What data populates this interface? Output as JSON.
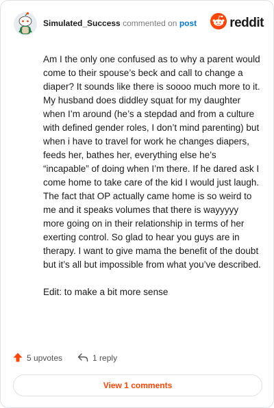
{
  "header": {
    "username": "Simulated_Success",
    "action": "commented on",
    "post_link": "post",
    "logo_text": "reddit"
  },
  "comment": {
    "paragraphs": [
      "Am I the only one confused as to why a parent would come to their spouse’s beck and call to change a diaper? It sounds like there is soooo much more to it. My husband does diddley squat for my daughter when I’m around (he’s a stepdad and from a culture with defined gender roles, I don’t mind parenting) but when i have to travel for work he changes diapers, feeds her, bathes her, everything else he’s “incapable” of doing when I’m there. If he dared ask I come home to take care of the kid I would just laugh. The fact that OP actually came home is so weird to me and it speaks volumes that there is wayyyyy more going on in their relationship in terms of her exerting control. So glad to hear you guys are in therapy. I want to give mama the benefit of the doubt but it’s all but impossible from what you’ve described.",
      "Edit: to make a bit more sense"
    ]
  },
  "footer": {
    "upvotes": "5 upvotes",
    "replies": "1 reply"
  },
  "view_comments": "View 1 comments",
  "icons": {
    "avatar": "snoo-avatar-icon",
    "logo": "reddit-logo-icon",
    "upvote": "upvote-arrow-icon",
    "reply": "reply-arrow-icon"
  },
  "colors": {
    "accent": "#ff4500",
    "link": "#0079d3",
    "border": "#dfe1e3"
  }
}
